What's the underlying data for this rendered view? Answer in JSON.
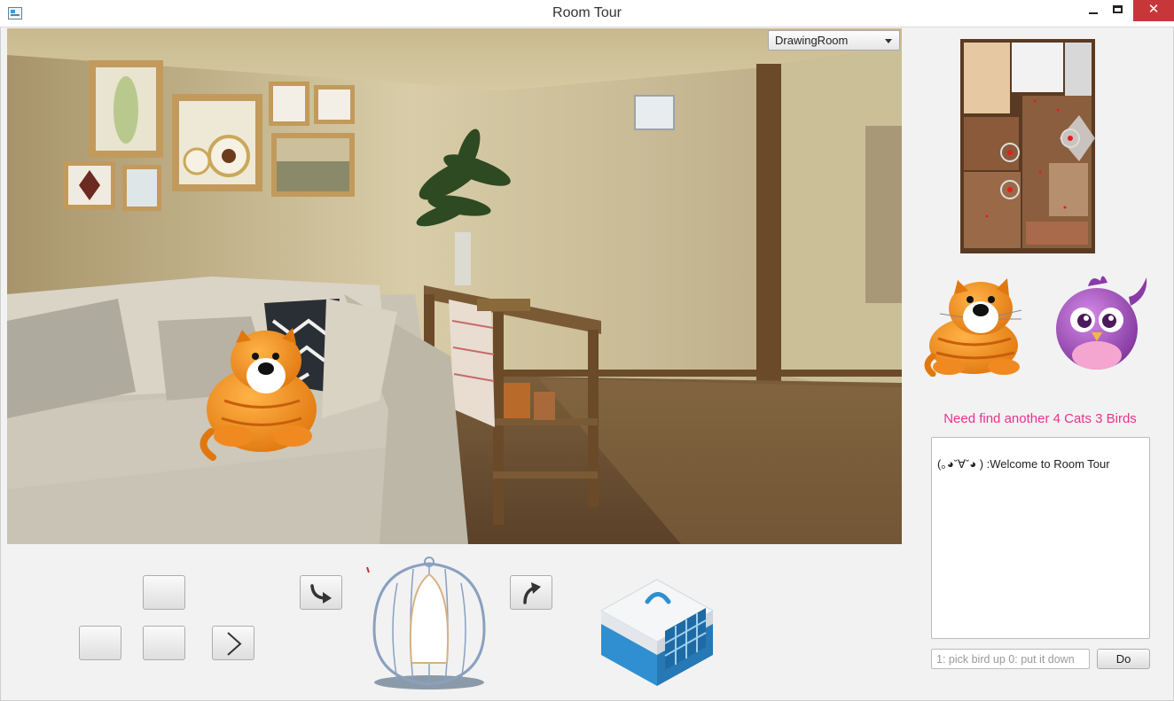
{
  "window": {
    "title": "Room Tour",
    "min_icon": "minimize-icon",
    "max_icon": "maximize-icon",
    "close_icon": "close-icon",
    "close_glyph": "✕"
  },
  "scene": {
    "room_select": {
      "value": "DrawingRoom",
      "icon": "chevron-down-icon"
    },
    "visible_items": [
      "cat"
    ],
    "scroll_icon": "triangle-up-icon"
  },
  "controls": {
    "forward_icon": "",
    "strafe_left_icon": "",
    "back_icon": "",
    "next_icon": "chevron-right-icon",
    "turn_left_icon": "curved-arrow-down-right-icon",
    "turn_right_icon": "curved-arrow-up-right-icon",
    "birdcage_icon": "birdcage-icon",
    "carrier_icon": "pet-carrier-icon"
  },
  "panel": {
    "minimap_icon": "floor-plan-map",
    "cat_icon": "cat-icon",
    "bird_icon": "bird-icon",
    "status_text": "Need find another 4 Cats 3 Birds",
    "status_color": "#e7338f",
    "log_lines": [
      "(｡◕ˇ∀ˇ◕ ) :Welcome to Room Tour"
    ],
    "command_placeholder": "1: pick bird up 0: put it down",
    "command_value": "",
    "do_label": "Do"
  }
}
